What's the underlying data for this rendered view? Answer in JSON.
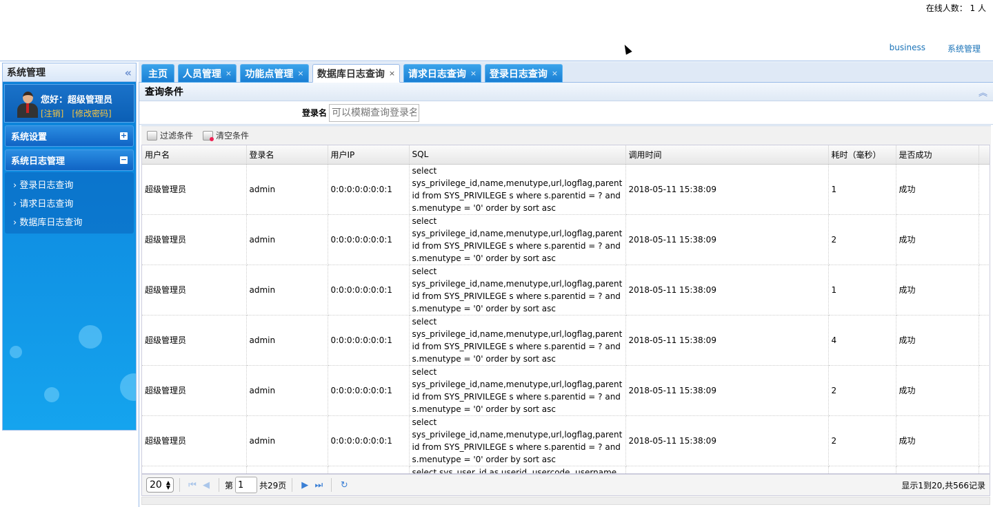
{
  "header": {
    "online": "在线人数： 1 人",
    "nav": [
      "business",
      "系统管理"
    ]
  },
  "sidebar": {
    "title": "系统管理",
    "greeting": "您好：超级管理员",
    "logout": "[注销]",
    "change_password": "[修改密码]",
    "menus": [
      {
        "label": "系统设置",
        "toggle": "+"
      },
      {
        "label": "系统日志管理",
        "toggle": "−"
      }
    ],
    "submenu": [
      "› 登录日志查询",
      "› 请求日志查询",
      "› 数据库日志查询"
    ]
  },
  "tabs": [
    {
      "label": "主页",
      "closable": false
    },
    {
      "label": "人员管理",
      "closable": true
    },
    {
      "label": "功能点管理",
      "closable": true
    },
    {
      "label": "数据库日志查询",
      "closable": true,
      "active": true
    },
    {
      "label": "请求日志查询",
      "closable": true
    },
    {
      "label": "登录日志查询",
      "closable": true
    }
  ],
  "query": {
    "title": "查询条件",
    "label": "登录名",
    "placeholder": "可以模糊查询登录名"
  },
  "toolbar": {
    "filter": "过滤条件",
    "clear": "清空条件"
  },
  "table": {
    "columns": [
      "用户名",
      "登录名",
      "用户IP",
      "SQL",
      "调用时间",
      "耗时（毫秒）",
      "是否成功"
    ],
    "rows": [
      [
        "超级管理员",
        "admin",
        "0:0:0:0:0:0:0:1",
        "select sys_privilege_id,name,menutype,url,logflag,parentid from SYS_PRIVILEGE s where s.parentid = ? and s.menutype = '0' order by sort asc",
        "2018-05-11 15:38:09",
        "1",
        "成功"
      ],
      [
        "超级管理员",
        "admin",
        "0:0:0:0:0:0:0:1",
        "select sys_privilege_id,name,menutype,url,logflag,parentid from SYS_PRIVILEGE s where s.parentid = ? and s.menutype = '0' order by sort asc",
        "2018-05-11 15:38:09",
        "2",
        "成功"
      ],
      [
        "超级管理员",
        "admin",
        "0:0:0:0:0:0:0:1",
        "select sys_privilege_id,name,menutype,url,logflag,parentid from SYS_PRIVILEGE s where s.parentid = ? and s.menutype = '0' order by sort asc",
        "2018-05-11 15:38:09",
        "1",
        "成功"
      ],
      [
        "超级管理员",
        "admin",
        "0:0:0:0:0:0:0:1",
        "select sys_privilege_id,name,menutype,url,logflag,parentid from SYS_PRIVILEGE s where s.parentid = ? and s.menutype = '0' order by sort asc",
        "2018-05-11 15:38:09",
        "4",
        "成功"
      ],
      [
        "超级管理员",
        "admin",
        "0:0:0:0:0:0:0:1",
        "select sys_privilege_id,name,menutype,url,logflag,parentid from SYS_PRIVILEGE s where s.parentid = ? and s.menutype = '0' order by sort asc",
        "2018-05-11 15:38:09",
        "2",
        "成功"
      ],
      [
        "超级管理员",
        "admin",
        "0:0:0:0:0:0:0:1",
        "select sys_privilege_id,name,menutype,url,logflag,parentid from SYS_PRIVILEGE s where s.parentid = ? and s.menutype = '0' order by sort asc",
        "2018-05-11 15:38:09",
        "2",
        "成功"
      ]
    ],
    "partial_sql": "select sys_user_id as userid, usercode, username,"
  },
  "pager": {
    "page_size": "20",
    "page_prefix": "第",
    "page": "1",
    "page_suffix": "共29页",
    "info": "显示1到20,共566记录"
  }
}
